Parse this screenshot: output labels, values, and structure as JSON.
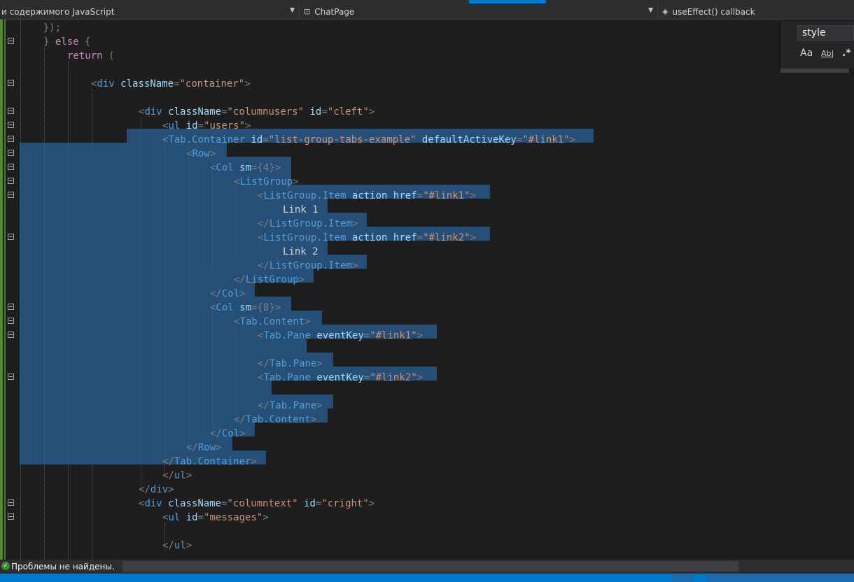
{
  "navbar": {
    "scope": "и содержимого JavaScript",
    "class_name": "ChatPage",
    "member": "useEffect() callback"
  },
  "find": {
    "query": "style",
    "match_case": "Aa",
    "whole_word": "Ab|",
    "regex": ".*"
  },
  "code_lines": [
    {
      "t": [
        [
          "pun",
          "    });"
        ]
      ]
    },
    {
      "t": [
        [
          "pun",
          "} "
        ],
        [
          "kw",
          "else"
        ],
        [
          "pun",
          " {"
        ]
      ]
    },
    {
      "t": [
        [
          "kw",
          "return"
        ],
        [
          "pun",
          " ("
        ]
      ]
    },
    {
      "t": []
    },
    {
      "t": [
        [
          "pun",
          "<"
        ],
        [
          "tag",
          "div"
        ],
        [
          "pun",
          " "
        ],
        [
          "attr",
          "className"
        ],
        [
          "pun",
          "="
        ],
        [
          "str",
          "\"container\""
        ],
        [
          "pun",
          ">"
        ]
      ]
    },
    {
      "t": []
    },
    {
      "t": [
        [
          "pun",
          "<"
        ],
        [
          "tag",
          "div"
        ],
        [
          "pun",
          " "
        ],
        [
          "attr",
          "className"
        ],
        [
          "pun",
          "="
        ],
        [
          "str",
          "\"columnusers\""
        ],
        [
          "pun",
          " "
        ],
        [
          "attr",
          "id"
        ],
        [
          "pun",
          "="
        ],
        [
          "str",
          "\"cleft\""
        ],
        [
          "pun",
          ">"
        ]
      ]
    },
    {
      "t": [
        [
          "pun",
          "<"
        ],
        [
          "tag",
          "ul"
        ],
        [
          "pun",
          " "
        ],
        [
          "attr",
          "id"
        ],
        [
          "pun",
          "="
        ],
        [
          "str",
          "\"users\""
        ],
        [
          "pun",
          ">"
        ]
      ]
    },
    {
      "t": [
        [
          "pun",
          "<"
        ],
        [
          "tag",
          "Tab.Container"
        ],
        [
          "pun",
          " "
        ],
        [
          "attr",
          "id"
        ],
        [
          "pun",
          "="
        ],
        [
          "str",
          "\"list-group-tabs-example\""
        ],
        [
          "pun",
          " "
        ],
        [
          "attr",
          "defaultActiveKey"
        ],
        [
          "pun",
          "="
        ],
        [
          "str",
          "\"#link1\""
        ],
        [
          "pun",
          ">"
        ]
      ]
    },
    {
      "t": [
        [
          "pun",
          "<"
        ],
        [
          "tag",
          "Row"
        ],
        [
          "pun",
          ">"
        ]
      ]
    },
    {
      "t": [
        [
          "pun",
          "<"
        ],
        [
          "tag",
          "Col"
        ],
        [
          "pun",
          " "
        ],
        [
          "attr",
          "sm"
        ],
        [
          "pun",
          "={4}>"
        ]
      ]
    },
    {
      "t": [
        [
          "pun",
          "<"
        ],
        [
          "tag",
          "ListGroup"
        ],
        [
          "pun",
          ">"
        ]
      ]
    },
    {
      "t": [
        [
          "pun",
          "<"
        ],
        [
          "tag",
          "ListGroup.Item"
        ],
        [
          "pun",
          " "
        ],
        [
          "attr",
          "action"
        ],
        [
          "pun",
          " "
        ],
        [
          "attr",
          "href"
        ],
        [
          "pun",
          "="
        ],
        [
          "str",
          "\"#link1\""
        ],
        [
          "pun",
          ">"
        ]
      ]
    },
    {
      "t": [
        [
          "txt",
          "Link 1"
        ]
      ]
    },
    {
      "t": [
        [
          "pun",
          "</"
        ],
        [
          "tag",
          "ListGroup.Item"
        ],
        [
          "pun",
          ">"
        ]
      ]
    },
    {
      "t": [
        [
          "pun",
          "<"
        ],
        [
          "tag",
          "ListGroup.Item"
        ],
        [
          "pun",
          " "
        ],
        [
          "attr",
          "action"
        ],
        [
          "pun",
          " "
        ],
        [
          "attr",
          "href"
        ],
        [
          "pun",
          "="
        ],
        [
          "str",
          "\"#link2\""
        ],
        [
          "pun",
          ">"
        ]
      ]
    },
    {
      "t": [
        [
          "txt",
          "Link 2"
        ]
      ]
    },
    {
      "t": [
        [
          "pun",
          "</"
        ],
        [
          "tag",
          "ListGroup.Item"
        ],
        [
          "pun",
          ">"
        ]
      ]
    },
    {
      "t": [
        [
          "pun",
          "</"
        ],
        [
          "tag",
          "ListGroup"
        ],
        [
          "pun",
          ">"
        ]
      ]
    },
    {
      "t": [
        [
          "pun",
          "</"
        ],
        [
          "tag",
          "Col"
        ],
        [
          "pun",
          ">"
        ]
      ]
    },
    {
      "t": [
        [
          "pun",
          "<"
        ],
        [
          "tag",
          "Col"
        ],
        [
          "pun",
          " "
        ],
        [
          "attr",
          "sm"
        ],
        [
          "pun",
          "={8}>"
        ]
      ]
    },
    {
      "t": [
        [
          "pun",
          "<"
        ],
        [
          "tag",
          "Tab.Content"
        ],
        [
          "pun",
          ">"
        ]
      ]
    },
    {
      "t": [
        [
          "pun",
          "<"
        ],
        [
          "tag",
          "Tab.Pane"
        ],
        [
          "pun",
          " "
        ],
        [
          "attr",
          "eventKey"
        ],
        [
          "pun",
          "="
        ],
        [
          "str",
          "\"#link1\""
        ],
        [
          "pun",
          ">"
        ]
      ]
    },
    {
      "t": []
    },
    {
      "t": [
        [
          "pun",
          "</"
        ],
        [
          "tag",
          "Tab.Pane"
        ],
        [
          "pun",
          ">"
        ]
      ]
    },
    {
      "t": [
        [
          "pun",
          "<"
        ],
        [
          "tag",
          "Tab.Pane"
        ],
        [
          "pun",
          " "
        ],
        [
          "attr",
          "eventKey"
        ],
        [
          "pun",
          "="
        ],
        [
          "str",
          "\"#link2\""
        ],
        [
          "pun",
          ">"
        ]
      ]
    },
    {
      "t": []
    },
    {
      "t": [
        [
          "pun",
          "</"
        ],
        [
          "tag",
          "Tab.Pane"
        ],
        [
          "pun",
          ">"
        ]
      ]
    },
    {
      "t": [
        [
          "pun",
          "</"
        ],
        [
          "tag",
          "Tab.Content"
        ],
        [
          "pun",
          ">"
        ]
      ]
    },
    {
      "t": [
        [
          "pun",
          "</"
        ],
        [
          "tag",
          "Col"
        ],
        [
          "pun",
          ">"
        ]
      ]
    },
    {
      "t": [
        [
          "pun",
          "</"
        ],
        [
          "tag",
          "Row"
        ],
        [
          "pun",
          ">"
        ]
      ]
    },
    {
      "t": [
        [
          "pun",
          "</"
        ],
        [
          "tag",
          "Tab.Container"
        ],
        [
          "pun",
          ">"
        ]
      ]
    },
    {
      "t": [
        [
          "pun",
          "</"
        ],
        [
          "tag",
          "ul"
        ],
        [
          "pun",
          ">"
        ]
      ]
    },
    {
      "t": [
        [
          "pun",
          "</"
        ],
        [
          "tag",
          "div"
        ],
        [
          "pun",
          ">"
        ]
      ]
    },
    {
      "t": [
        [
          "pun",
          "<"
        ],
        [
          "tag",
          "div"
        ],
        [
          "pun",
          " "
        ],
        [
          "attr",
          "className"
        ],
        [
          "pun",
          "="
        ],
        [
          "str",
          "\"columntext\""
        ],
        [
          "pun",
          " "
        ],
        [
          "attr",
          "id"
        ],
        [
          "pun",
          "="
        ],
        [
          "str",
          "\"cright\""
        ],
        [
          "pun",
          ">"
        ]
      ]
    },
    {
      "t": [
        [
          "pun",
          "<"
        ],
        [
          "tag",
          "ul"
        ],
        [
          "pun",
          " "
        ],
        [
          "attr",
          "id"
        ],
        [
          "pun",
          "="
        ],
        [
          "str",
          "\"messages\""
        ],
        [
          "pun",
          ">"
        ]
      ]
    },
    {
      "t": []
    },
    {
      "t": [
        [
          "pun",
          "</"
        ],
        [
          "tag",
          "ul"
        ],
        [
          "pun",
          ">"
        ]
      ]
    }
  ],
  "status": {
    "problems": "Проблемы не найдены."
  }
}
